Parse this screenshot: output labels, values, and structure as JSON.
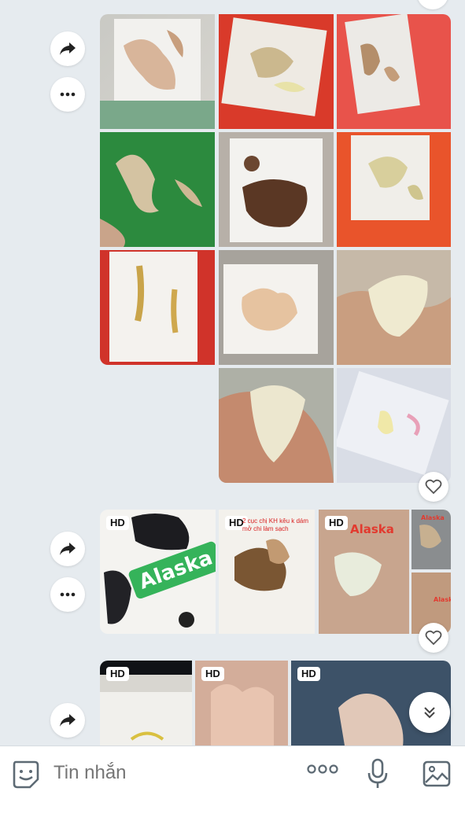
{
  "composer": {
    "placeholder": "Tin nhắn",
    "sticker_icon": "sticker-icon",
    "more_icon": "more-dots-icon",
    "mic_icon": "microphone-icon",
    "gallery_icon": "image-gallery-icon"
  },
  "messages": [
    {
      "type": "photo-grid",
      "photo_count": 11,
      "reaction_icon": "heart-outline-icon"
    },
    {
      "type": "photo-grid",
      "photo_count": 5,
      "badges": [
        "HD",
        "HD",
        "HD"
      ],
      "overlays": {
        "green_tag": "Alaska",
        "red_caption": "2 cục chị KH kêu k dám mở chi làm sạch",
        "red_tag": "Alaska",
        "small_tag_1": "Alaska",
        "small_tag_2": "Alask"
      },
      "reaction_icon": "heart-outline-icon"
    },
    {
      "type": "photo-grid",
      "badges": [
        "HD",
        "HD",
        "HD"
      ]
    }
  ],
  "colors": {
    "background": "#e6ebef",
    "alaska_green": "#35b35a",
    "alaska_red": "#e23a2f"
  }
}
